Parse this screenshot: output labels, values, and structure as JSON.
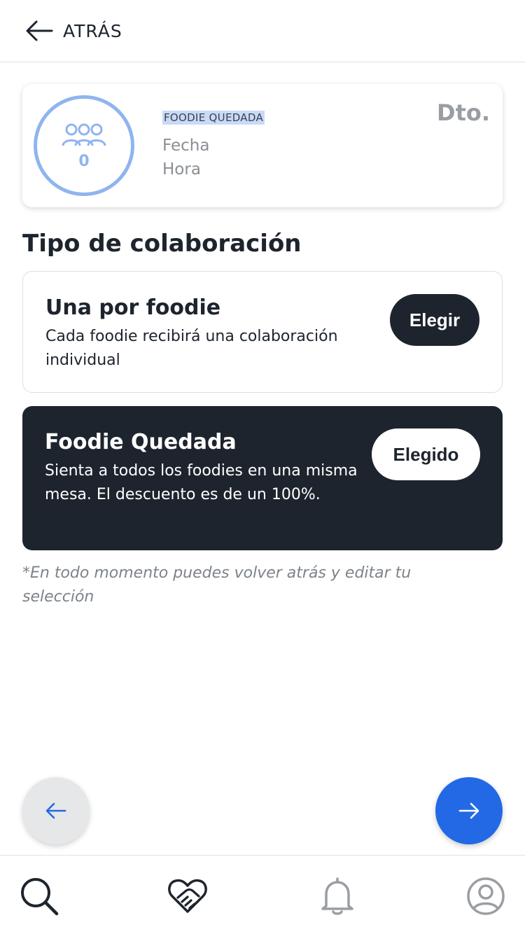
{
  "header": {
    "back_label": "ATRÁS"
  },
  "summary": {
    "people_count": "0",
    "type_label": "FOODIE QUEDADA",
    "date_label": "Fecha",
    "time_label": "Hora",
    "discount_label": "Dto."
  },
  "section_title": "Tipo de colaboración",
  "options": [
    {
      "title": "Una por foodie",
      "description": "Cada foodie recibirá una colaboración individual",
      "button_label": "Elegir",
      "selected": false
    },
    {
      "title": "Foodie Quedada",
      "description": "Sienta a todos los foodies en una misma mesa. El descuento es de un 100%.",
      "button_label": "Elegido",
      "selected": true
    }
  ],
  "footnote": "*En todo momento puedes volver atrás y editar tu selección",
  "nav": {
    "icons": [
      "search-icon",
      "handshake-heart-icon",
      "bell-icon",
      "profile-icon"
    ],
    "active": "handshake-heart-icon"
  },
  "colors": {
    "primary_dark": "#1d242d",
    "accent_blue": "#2369e6",
    "ring_blue": "#8fb4f0",
    "muted_text": "#8a8f95"
  }
}
